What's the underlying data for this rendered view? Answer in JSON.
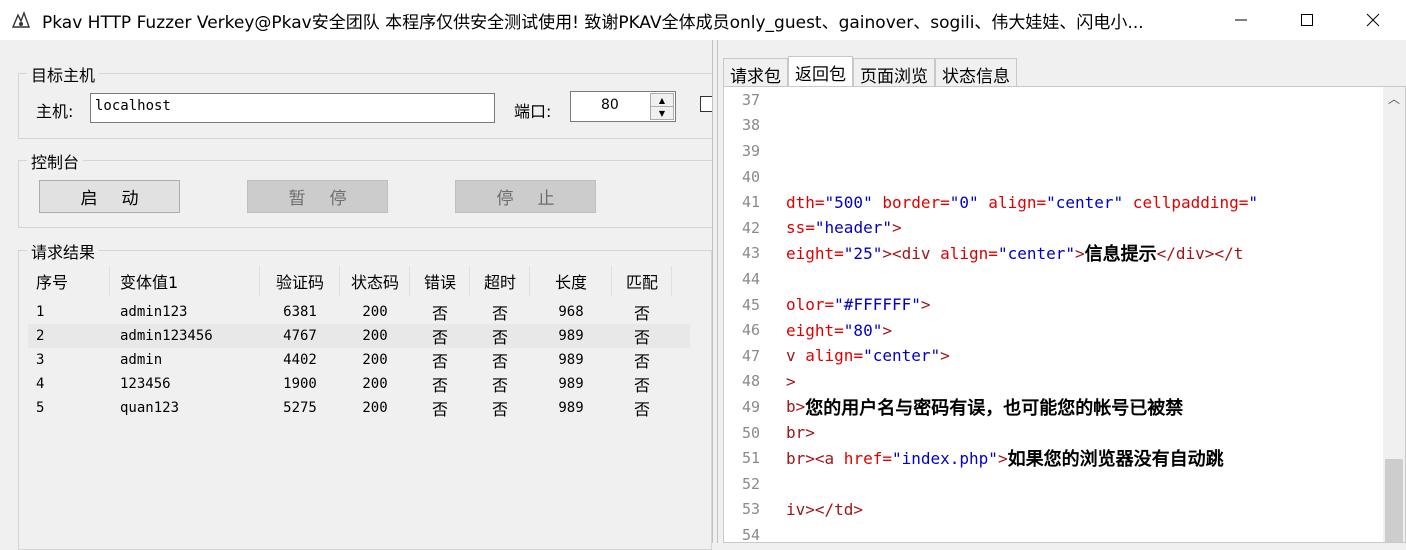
{
  "window": {
    "title": "Pkav HTTP Fuzzer   Verkey@Pkav安全团队  本程序仅供安全测试使用!  致谢PKAV全体成员only_guest、gainover、sogili、伟大娃娃、闪电小..."
  },
  "target": {
    "legend": "目标主机",
    "host_label": "主机:",
    "host_value": "localhost",
    "port_label": "端口:",
    "port_value": "80"
  },
  "console": {
    "legend": "控制台",
    "start": "启动",
    "pause": "暂停",
    "stop": "停止"
  },
  "results": {
    "legend": "请求结果",
    "columns": [
      "序号",
      "变体值1",
      "验证码",
      "状态码",
      "错误",
      "超时",
      "长度",
      "匹配"
    ],
    "rows": [
      [
        "1",
        "admin123",
        "6381",
        "200",
        "否",
        "否",
        "968",
        "否"
      ],
      [
        "2",
        "admin123456",
        "4767",
        "200",
        "否",
        "否",
        "989",
        "否"
      ],
      [
        "3",
        "admin",
        "4402",
        "200",
        "否",
        "否",
        "989",
        "否"
      ],
      [
        "4",
        "123456",
        "1900",
        "200",
        "否",
        "否",
        "989",
        "否"
      ],
      [
        "5",
        "quan123",
        "5275",
        "200",
        "否",
        "否",
        "989",
        "否"
      ]
    ],
    "selected_row": 1
  },
  "tabs": [
    "请求包",
    "返回包",
    "页面浏览",
    "状态信息"
  ],
  "active_tab": 1,
  "editor": {
    "lines": [
      {
        "n": "37",
        "parts": []
      },
      {
        "n": "38",
        "parts": []
      },
      {
        "n": "39",
        "parts": []
      },
      {
        "n": "40",
        "parts": []
      },
      {
        "n": "41",
        "parts": [
          [
            "attr",
            "dth="
          ],
          [
            "val",
            "\"500\""
          ],
          [
            "attr",
            " border="
          ],
          [
            "val",
            "\"0\""
          ],
          [
            "attr",
            " align="
          ],
          [
            "val",
            "\"center\""
          ],
          [
            "attr",
            " cellpadding="
          ],
          [
            "val",
            "\""
          ]
        ]
      },
      {
        "n": "42",
        "parts": [
          [
            "attr",
            "ss="
          ],
          [
            "val",
            "\"header\""
          ],
          [
            "tag",
            ">"
          ]
        ]
      },
      {
        "n": "43",
        "parts": [
          [
            "attr",
            "eight="
          ],
          [
            "val",
            "\"25\""
          ],
          [
            "tag",
            "><div"
          ],
          [
            "attr",
            " align="
          ],
          [
            "val",
            "\"center\""
          ],
          [
            "tag",
            ">"
          ],
          [
            "txt",
            "信息提示"
          ],
          [
            "tag",
            "</div></t"
          ]
        ]
      },
      {
        "n": "44",
        "parts": []
      },
      {
        "n": "45",
        "parts": [
          [
            "attr",
            "olor="
          ],
          [
            "val",
            "\"#FFFFFF\""
          ],
          [
            "tag",
            ">"
          ]
        ]
      },
      {
        "n": "46",
        "parts": [
          [
            "attr",
            "eight="
          ],
          [
            "val",
            "\"80\""
          ],
          [
            "tag",
            ">"
          ]
        ]
      },
      {
        "n": "47",
        "parts": [
          [
            "tag",
            "v"
          ],
          [
            "attr",
            " align="
          ],
          [
            "val",
            "\"center\""
          ],
          [
            "tag",
            ">"
          ]
        ]
      },
      {
        "n": "48",
        "parts": [
          [
            "tag",
            ">"
          ]
        ]
      },
      {
        "n": "49",
        "parts": [
          [
            "tag",
            "b>"
          ],
          [
            "txt",
            "您的用户名与密码有误，也可能您的帐号已被禁"
          ]
        ]
      },
      {
        "n": "50",
        "parts": [
          [
            "tag",
            "br>"
          ]
        ]
      },
      {
        "n": "51",
        "parts": [
          [
            "tag",
            "br><a"
          ],
          [
            "attr",
            " href="
          ],
          [
            "val",
            "\"index.php\""
          ],
          [
            "tag",
            ">"
          ],
          [
            "txt",
            "如果您的浏览器没有自动跳"
          ]
        ]
      },
      {
        "n": "52",
        "parts": []
      },
      {
        "n": "53",
        "parts": [
          [
            "tag",
            "iv></td>"
          ]
        ]
      },
      {
        "n": "54",
        "parts": []
      }
    ]
  },
  "icons": {
    "app": "pkav-logo-icon",
    "minimize": "minimize-icon",
    "maximize": "maximize-icon",
    "close": "close-icon",
    "scroll_up": "chevron-up-icon"
  }
}
